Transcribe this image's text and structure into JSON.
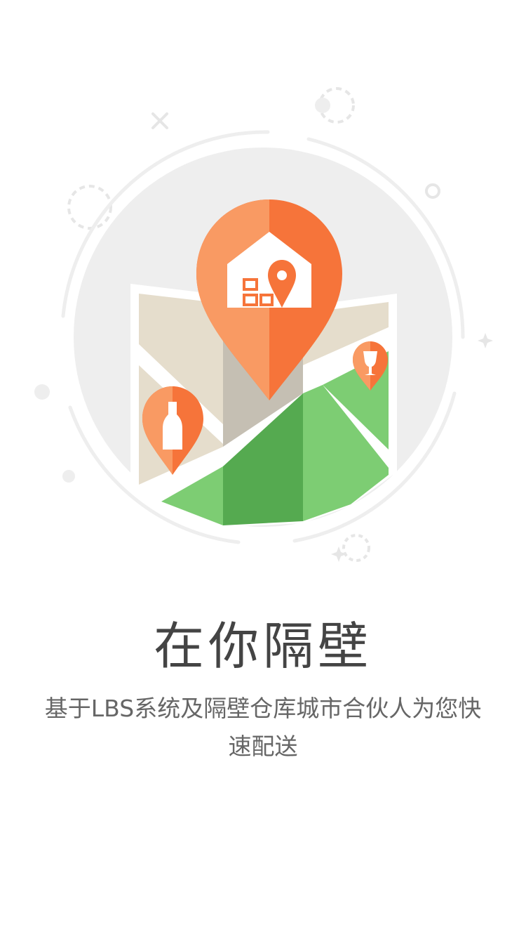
{
  "title": "在你隔壁",
  "subtitle": "基于LBS系统及隔壁仓库城市合伙人为您快速配送",
  "colors": {
    "accent_orange": "#f6743a",
    "accent_orange_light": "#f99a63",
    "map_green": "#7dcd73",
    "map_green_dark": "#55aa50",
    "map_beige": "#e5ddcc",
    "map_gray": "#c5bfb3",
    "circle_bg": "#eeeeee",
    "title_text": "#444444",
    "body_text": "#666666"
  },
  "icons": {
    "main_pin": "warehouse-location-pin-icon",
    "left_pin": "bottle-pin-icon",
    "right_pin": "wine-glass-pin-icon"
  }
}
